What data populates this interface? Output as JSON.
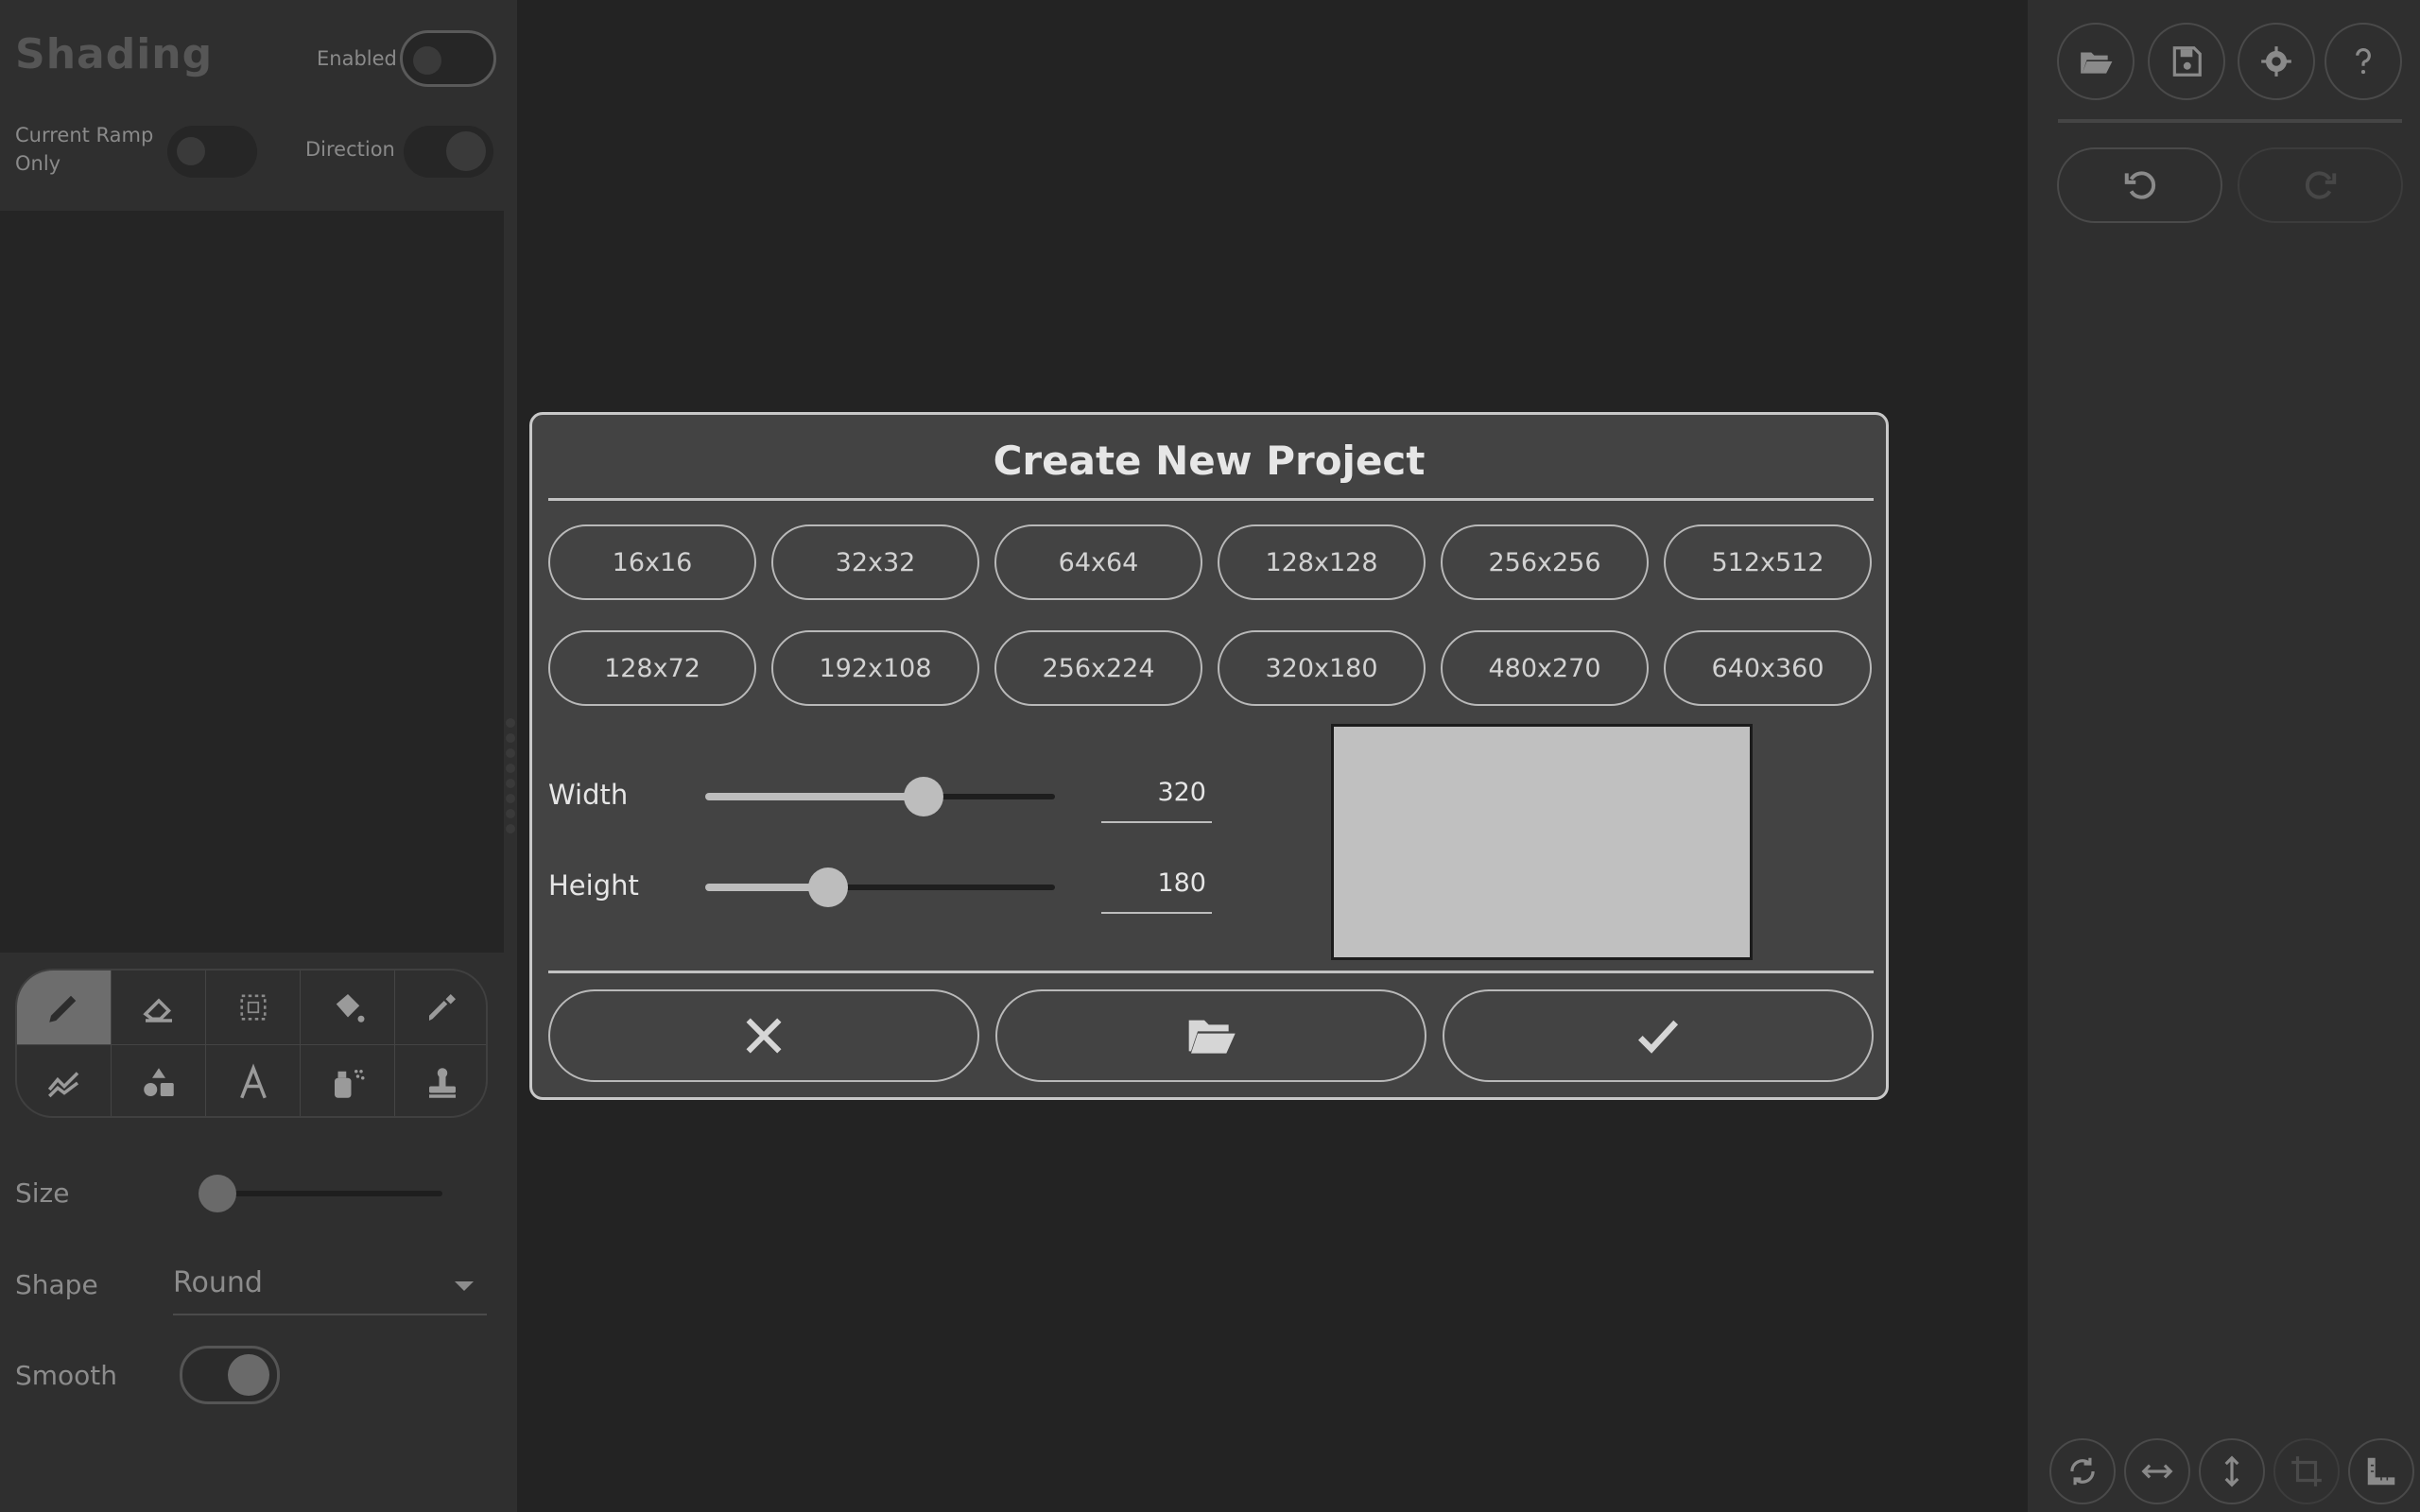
{
  "left_panel": {
    "title": "Shading",
    "enabled_label": "Enabled",
    "current_ramp_label": "Current Ramp Only",
    "direction_label": "Direction",
    "tools": [
      "pencil",
      "eraser",
      "select",
      "fill-bucket",
      "eyedropper",
      "shading",
      "shapes",
      "text",
      "spray",
      "stamp"
    ],
    "size_label": "Size",
    "shape_label": "Shape",
    "shape_value": "Round",
    "smooth_label": "Smooth"
  },
  "dialog": {
    "title": "Create New Project",
    "presets_row1": [
      "16x16",
      "32x32",
      "64x64",
      "128x128",
      "256x256",
      "512x512"
    ],
    "presets_row2": [
      "128x72",
      "192x108",
      "256x224",
      "320x180",
      "480x270",
      "640x360"
    ],
    "width_label": "Width",
    "width_value": "320",
    "height_label": "Height",
    "height_value": "180",
    "actions": [
      "cancel",
      "open-folder",
      "confirm"
    ]
  },
  "right_panel": {
    "top_buttons": [
      "open-folder",
      "save",
      "settings",
      "help"
    ],
    "history_buttons": [
      "undo",
      "redo"
    ],
    "bottom_buttons": [
      "rotate",
      "flip-horizontal",
      "flip-vertical",
      "crop",
      "ruler"
    ]
  },
  "colors": {
    "panel": "#2f2f2f",
    "background": "#232323",
    "dialog": "#434343",
    "accent": "#c8c8c8"
  }
}
